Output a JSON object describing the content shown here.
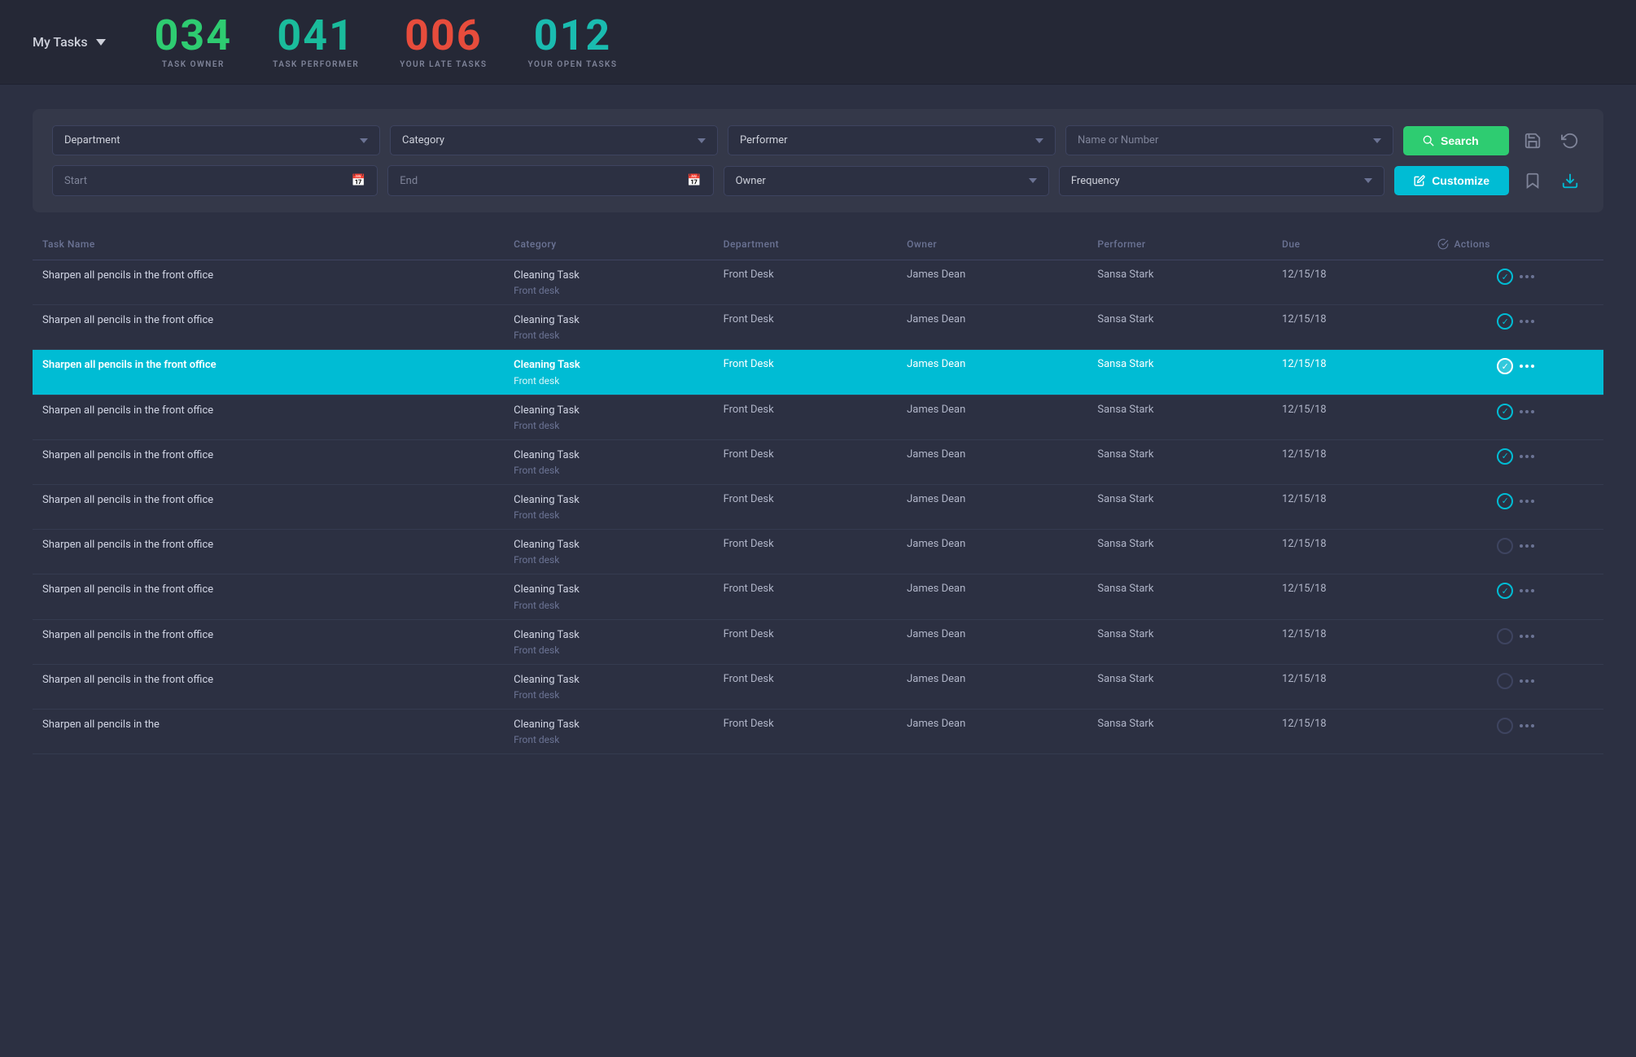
{
  "header": {
    "my_tasks_label": "My Tasks",
    "stats": [
      {
        "number": "034",
        "label": "TASK OWNER",
        "color": "green"
      },
      {
        "number": "041",
        "label": "TASK PERFORMER",
        "color": "cyan"
      },
      {
        "number": "006",
        "label": "YOUR LATE TASKS",
        "color": "red"
      },
      {
        "number": "012",
        "label": "YOUR OPEN TASKS",
        "color": "teal"
      }
    ]
  },
  "filters": {
    "row1": [
      {
        "id": "department",
        "label": "Department",
        "type": "select"
      },
      {
        "id": "category",
        "label": "Category",
        "type": "select"
      },
      {
        "id": "performer",
        "label": "Performer",
        "type": "select"
      },
      {
        "id": "name_or_number",
        "label": "Name or Number",
        "type": "input"
      }
    ],
    "row2": [
      {
        "id": "start",
        "label": "Start",
        "type": "date"
      },
      {
        "id": "end",
        "label": "End",
        "type": "date"
      },
      {
        "id": "owner",
        "label": "Owner",
        "type": "select"
      },
      {
        "id": "frequency",
        "label": "Frequency",
        "type": "select"
      }
    ],
    "search_label": "Search",
    "customize_label": "Customize"
  },
  "table": {
    "columns": [
      {
        "id": "task_name",
        "label": "Task Name"
      },
      {
        "id": "category",
        "label": "Category"
      },
      {
        "id": "department",
        "label": "Department"
      },
      {
        "id": "owner",
        "label": "Owner"
      },
      {
        "id": "performer",
        "label": "Performer"
      },
      {
        "id": "due",
        "label": "Due"
      },
      {
        "id": "actions",
        "label": "Actions"
      }
    ],
    "rows": [
      {
        "id": 1,
        "task_name": "Sharpen all pencils in the front office",
        "category": "Cleaning Task",
        "category_sub": "Front desk",
        "department": "Front Desk",
        "owner": "James Dean",
        "performer": "Sansa Stark",
        "due": "12/15/18",
        "selected": false,
        "check_active": true
      },
      {
        "id": 2,
        "task_name": "Sharpen all pencils in the front office",
        "category": "Cleaning Task",
        "category_sub": "Front desk",
        "department": "Front Desk",
        "owner": "James Dean",
        "performer": "Sansa Stark",
        "due": "12/15/18",
        "selected": false,
        "check_active": true
      },
      {
        "id": 3,
        "task_name": "Sharpen all pencils in the front office",
        "category": "Cleaning Task",
        "category_sub": "Front desk",
        "department": "Front Desk",
        "owner": "James Dean",
        "performer": "Sansa Stark",
        "due": "12/15/18",
        "selected": true,
        "check_active": true
      },
      {
        "id": 4,
        "task_name": "Sharpen all pencils in the front office",
        "category": "Cleaning Task",
        "category_sub": "Front desk",
        "department": "Front Desk",
        "owner": "James Dean",
        "performer": "Sansa Stark",
        "due": "12/15/18",
        "selected": false,
        "check_active": true
      },
      {
        "id": 5,
        "task_name": "Sharpen all pencils in the front office",
        "category": "Cleaning Task",
        "category_sub": "Front desk",
        "department": "Front Desk",
        "owner": "James Dean",
        "performer": "Sansa Stark",
        "due": "12/15/18",
        "selected": false,
        "check_active": true
      },
      {
        "id": 6,
        "task_name": "Sharpen all pencils in the front office",
        "category": "Cleaning Task",
        "category_sub": "Front desk",
        "department": "Front Desk",
        "owner": "James Dean",
        "performer": "Sansa Stark",
        "due": "12/15/18",
        "selected": false,
        "check_active": true
      },
      {
        "id": 7,
        "task_name": "Sharpen all pencils in the front office",
        "category": "Cleaning Task",
        "category_sub": "Front desk",
        "department": "Front Desk",
        "owner": "James Dean",
        "performer": "Sansa Stark",
        "due": "12/15/18",
        "selected": false,
        "check_active": false
      },
      {
        "id": 8,
        "task_name": "Sharpen all pencils in the front office",
        "category": "Cleaning Task",
        "category_sub": "Front desk",
        "department": "Front Desk",
        "owner": "James Dean",
        "performer": "Sansa Stark",
        "due": "12/15/18",
        "selected": false,
        "check_active": true
      },
      {
        "id": 9,
        "task_name": "Sharpen all pencils in the front office",
        "category": "Cleaning Task",
        "category_sub": "Front desk",
        "department": "Front Desk",
        "owner": "James Dean",
        "performer": "Sansa Stark",
        "due": "12/15/18",
        "selected": false,
        "check_active": false
      },
      {
        "id": 10,
        "task_name": "Sharpen all pencils in the front office",
        "category": "Cleaning Task",
        "category_sub": "Front desk",
        "department": "Front Desk",
        "owner": "James Dean",
        "performer": "Sansa Stark",
        "due": "12/15/18",
        "selected": false,
        "check_active": false
      },
      {
        "id": 11,
        "task_name": "Sharpen all pencils in the",
        "category": "Cleaning Task",
        "category_sub": "Front desk",
        "department": "Front Desk",
        "owner": "James Dean",
        "performer": "Sansa Stark",
        "due": "12/15/18",
        "selected": false,
        "check_active": false
      }
    ]
  }
}
